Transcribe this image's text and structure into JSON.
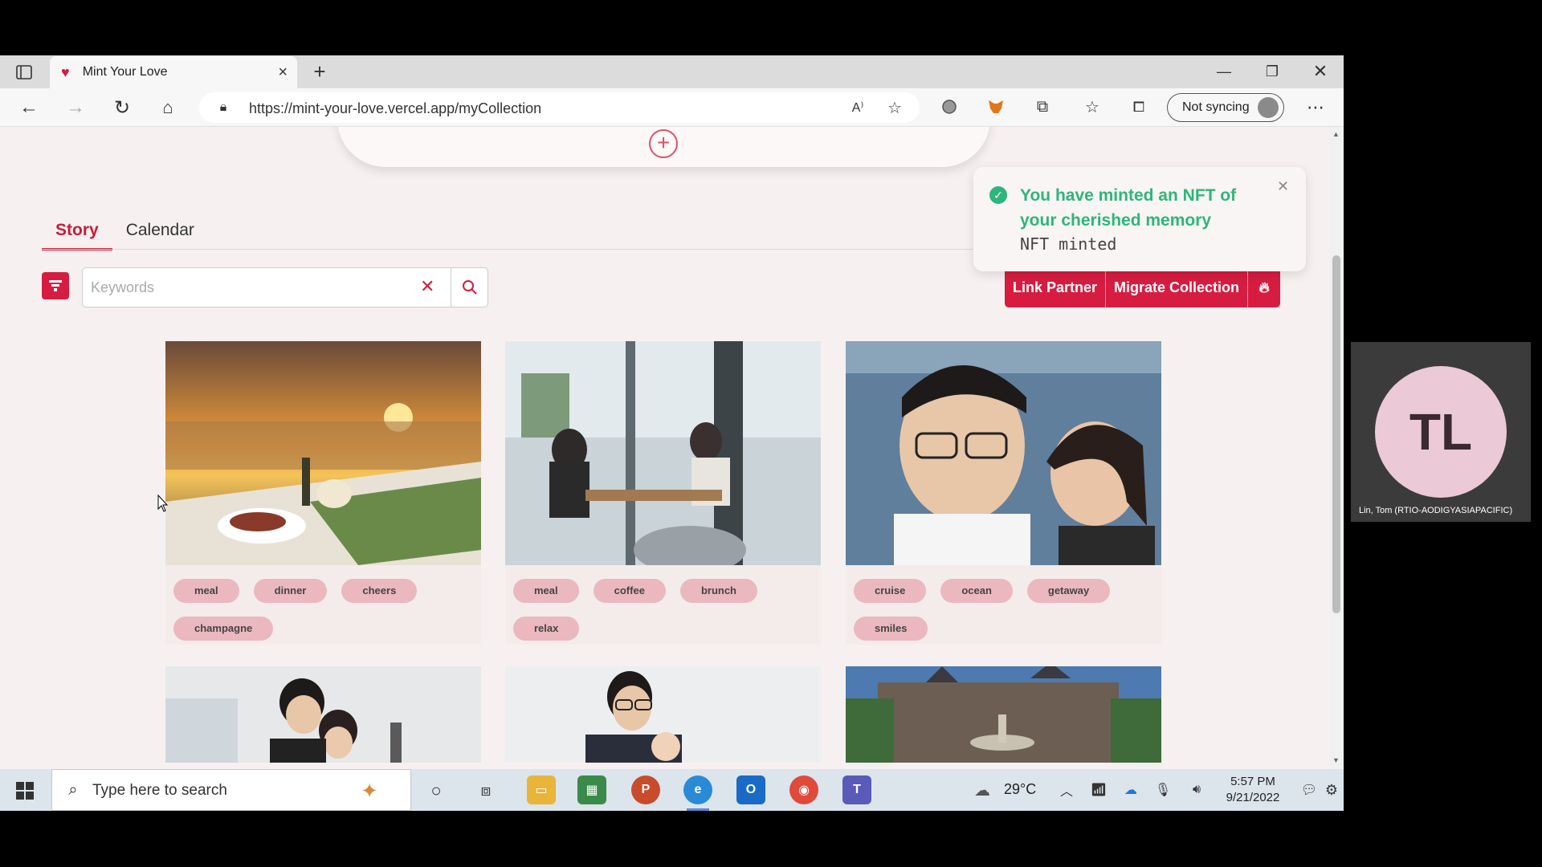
{
  "browser": {
    "tab_title": "Mint Your Love",
    "url": "https://mint-your-love.vercel.app/myCollection",
    "sync_label": "Not syncing"
  },
  "page": {
    "tabs": [
      "Story",
      "Calendar"
    ],
    "search_placeholder": "Keywords",
    "buttons": {
      "link_partner": "Link Partner",
      "migrate": "Migrate Collection"
    },
    "toast": {
      "title": "You have minted an NFT of your cherished memory",
      "subtitle": "NFT minted"
    },
    "cards": [
      {
        "tags": [
          "meal",
          "dinner",
          "cheers",
          "champagne"
        ]
      },
      {
        "tags": [
          "meal",
          "coffee",
          "brunch",
          "relax"
        ]
      },
      {
        "tags": [
          "cruise",
          "ocean",
          "getaway",
          "smiles"
        ]
      }
    ]
  },
  "video_tile": {
    "initials": "TL",
    "name": "Lin, Tom (RTIO-AODIGYASIAPACIFIC)"
  },
  "taskbar": {
    "search_text": "Type here to search",
    "weather": "29°C",
    "time": "5:57 PM",
    "date": "9/21/2022"
  },
  "colors": {
    "accent": "#d61d41",
    "success": "#2fb57a",
    "tag": "#ebb8c0"
  }
}
